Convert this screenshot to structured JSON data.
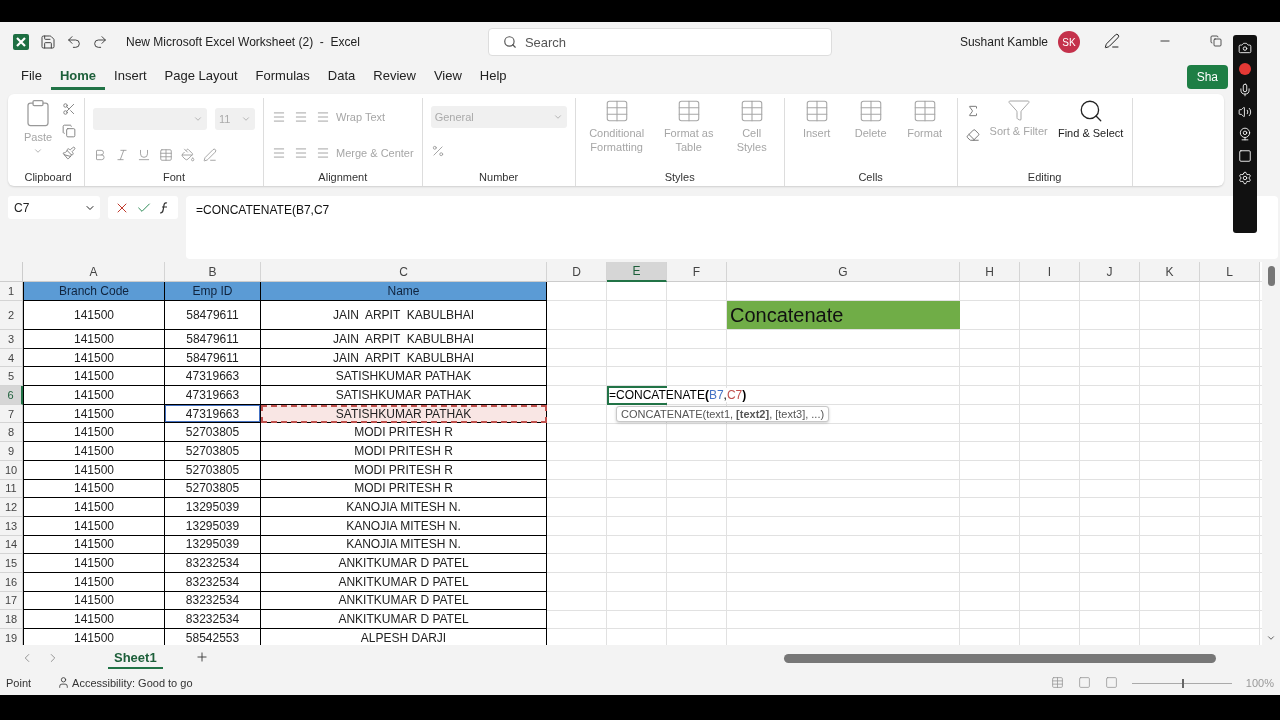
{
  "window": {
    "title": "New Microsoft Excel Worksheet (2)  -  Excel",
    "search_placeholder": "Search",
    "user_name": "Sushant Kamble",
    "user_initials": "SK",
    "share_label": "Sha"
  },
  "menu": [
    {
      "label": "File",
      "selected": false
    },
    {
      "label": "Home",
      "selected": true
    },
    {
      "label": "Insert",
      "selected": false
    },
    {
      "label": "Page Layout",
      "selected": false
    },
    {
      "label": "Formulas",
      "selected": false
    },
    {
      "label": "Data",
      "selected": false
    },
    {
      "label": "Review",
      "selected": false
    },
    {
      "label": "View",
      "selected": false
    },
    {
      "label": "Help",
      "selected": false
    }
  ],
  "ribbon": {
    "groups": [
      {
        "kind": "clipboard",
        "label": "Clipboard",
        "paste": {
          "label": "Paste",
          "disabled": true
        }
      },
      {
        "kind": "font",
        "label": "Font",
        "font_size": "11"
      },
      {
        "kind": "alignment",
        "label": "Alignment",
        "wrap": {
          "label": "Wrap Text",
          "disabled": true
        },
        "merge": {
          "label": "Merge & Center",
          "disabled": true
        }
      },
      {
        "kind": "number",
        "label": "Number",
        "format": "General"
      },
      {
        "kind": "buttons",
        "label": "Styles",
        "buttons": [
          {
            "label": "Conditional Formatting",
            "disabled": true
          },
          {
            "label": "Format as Table",
            "disabled": true
          },
          {
            "label": "Cell Styles",
            "disabled": true
          }
        ]
      },
      {
        "kind": "buttons",
        "label": "Cells",
        "buttons": [
          {
            "label": "Insert",
            "disabled": true
          },
          {
            "label": "Delete",
            "disabled": true
          },
          {
            "label": "Format",
            "disabled": true
          }
        ]
      },
      {
        "kind": "editing",
        "label": "Editing",
        "buttons": [
          {
            "label": "Sort & Filter",
            "disabled": true
          },
          {
            "label": "Find & Select",
            "disabled": false
          }
        ]
      }
    ]
  },
  "formula_bar": {
    "name_box": "C7",
    "formula": "=CONCATENATE(B7,C7"
  },
  "sheet": {
    "columns": [
      {
        "label": "A",
        "selected": false
      },
      {
        "label": "B",
        "selected": false
      },
      {
        "label": "C",
        "selected": false
      },
      {
        "label": "D",
        "selected": false
      },
      {
        "label": "E",
        "selected": true
      },
      {
        "label": "F",
        "selected": false
      },
      {
        "label": "G",
        "selected": false
      },
      {
        "label": "H",
        "selected": false
      },
      {
        "label": "I",
        "selected": false
      },
      {
        "label": "J",
        "selected": false
      },
      {
        "label": "K",
        "selected": false
      },
      {
        "label": "L",
        "selected": false
      }
    ],
    "rows": [
      {
        "label": "1",
        "selected": false,
        "cells": [
          {
            "text": "Branch Code",
            "kind": "header"
          },
          {
            "text": "Emp ID",
            "kind": "header"
          },
          {
            "text": "Name",
            "kind": "header"
          }
        ]
      },
      {
        "label": "2",
        "selected": false,
        "cells": [
          {
            "text": "141500",
            "kind": "plain"
          },
          {
            "text": "58479611",
            "kind": "plain"
          },
          {
            "text": "JAIN  ARPIT  KABULBHAI",
            "kind": "plain"
          }
        ],
        "side_label": "Concatenate"
      },
      {
        "label": "3",
        "selected": false,
        "cells": [
          {
            "text": "141500",
            "kind": "plain"
          },
          {
            "text": "58479611",
            "kind": "plain"
          },
          {
            "text": "JAIN  ARPIT  KABULBHAI",
            "kind": "plain"
          }
        ]
      },
      {
        "label": "4",
        "selected": false,
        "cells": [
          {
            "text": "141500",
            "kind": "plain"
          },
          {
            "text": "58479611",
            "kind": "plain"
          },
          {
            "text": "JAIN  ARPIT  KABULBHAI",
            "kind": "plain"
          }
        ]
      },
      {
        "label": "5",
        "selected": false,
        "cells": [
          {
            "text": "141500",
            "kind": "plain"
          },
          {
            "text": "47319663",
            "kind": "plain"
          },
          {
            "text": "SATISHKUMAR PATHAK",
            "kind": "plain"
          }
        ]
      },
      {
        "label": "6",
        "selected": true,
        "cells": [
          {
            "text": "141500",
            "kind": "plain"
          },
          {
            "text": "47319663",
            "kind": "plain"
          },
          {
            "text": "SATISHKUMAR PATHAK",
            "kind": "plain"
          }
        ],
        "entry": [
          {
            "text": "=CONCATENATE",
            "kind": "text"
          },
          {
            "text": "(",
            "kind": "bracket"
          },
          {
            "text": "B7",
            "kind": "reference",
            "color": "#4472c4"
          },
          {
            "text": ",",
            "kind": "text"
          },
          {
            "text": "C7",
            "kind": "reference",
            "color": "#c0504d"
          },
          {
            "text": ")",
            "kind": "bracket"
          }
        ]
      },
      {
        "label": "7",
        "selected": false,
        "cells": [
          {
            "text": "141500",
            "kind": "plain"
          },
          {
            "text": "47319663",
            "kind": "reference"
          },
          {
            "text": "SATISHKUMAR PATHAK",
            "kind": "marquee"
          }
        ],
        "tooltip": "CONCATENATE(text1, **[text2]**, [text3], ...)"
      },
      {
        "label": "8",
        "selected": false,
        "cells": [
          {
            "text": "141500",
            "kind": "plain"
          },
          {
            "text": "52703805",
            "kind": "plain"
          },
          {
            "text": "MODI PRITESH R",
            "kind": "plain"
          }
        ]
      },
      {
        "label": "9",
        "selected": false,
        "cells": [
          {
            "text": "141500",
            "kind": "plain"
          },
          {
            "text": "52703805",
            "kind": "plain"
          },
          {
            "text": "MODI PRITESH R",
            "kind": "plain"
          }
        ]
      },
      {
        "label": "10",
        "selected": false,
        "cells": [
          {
            "text": "141500",
            "kind": "plain"
          },
          {
            "text": "52703805",
            "kind": "plain"
          },
          {
            "text": "MODI PRITESH R",
            "kind": "plain"
          }
        ]
      },
      {
        "label": "11",
        "selected": false,
        "cells": [
          {
            "text": "141500",
            "kind": "plain"
          },
          {
            "text": "52703805",
            "kind": "plain"
          },
          {
            "text": "MODI PRITESH R",
            "kind": "plain"
          }
        ]
      },
      {
        "label": "12",
        "selected": false,
        "cells": [
          {
            "text": "141500",
            "kind": "plain"
          },
          {
            "text": "13295039",
            "kind": "plain"
          },
          {
            "text": "KANOJIA MITESH N.",
            "kind": "plain"
          }
        ]
      },
      {
        "label": "13",
        "selected": false,
        "cells": [
          {
            "text": "141500",
            "kind": "plain"
          },
          {
            "text": "13295039",
            "kind": "plain"
          },
          {
            "text": "KANOJIA MITESH N.",
            "kind": "plain"
          }
        ]
      },
      {
        "label": "14",
        "selected": false,
        "cells": [
          {
            "text": "141500",
            "kind": "plain"
          },
          {
            "text": "13295039",
            "kind": "plain"
          },
          {
            "text": "KANOJIA MITESH N.",
            "kind": "plain"
          }
        ]
      },
      {
        "label": "15",
        "selected": false,
        "cells": [
          {
            "text": "141500",
            "kind": "plain"
          },
          {
            "text": "83232534",
            "kind": "plain"
          },
          {
            "text": "ANKITKUMAR D PATEL",
            "kind": "plain"
          }
        ]
      },
      {
        "label": "16",
        "selected": false,
        "cells": [
          {
            "text": "141500",
            "kind": "plain"
          },
          {
            "text": "83232534",
            "kind": "plain"
          },
          {
            "text": "ANKITKUMAR D PATEL",
            "kind": "plain"
          }
        ]
      },
      {
        "label": "17",
        "selected": false,
        "cells": [
          {
            "text": "141500",
            "kind": "plain"
          },
          {
            "text": "83232534",
            "kind": "plain"
          },
          {
            "text": "ANKITKUMAR D PATEL",
            "kind": "plain"
          }
        ]
      },
      {
        "label": "18",
        "selected": false,
        "cells": [
          {
            "text": "141500",
            "kind": "plain"
          },
          {
            "text": "83232534",
            "kind": "plain"
          },
          {
            "text": "ANKITKUMAR D PATEL",
            "kind": "plain"
          }
        ]
      },
      {
        "label": "19",
        "selected": false,
        "cells": [
          {
            "text": "141500",
            "kind": "plain"
          },
          {
            "text": "58542553",
            "kind": "plain"
          },
          {
            "text": "ALPESH DARJI",
            "kind": "plain"
          }
        ]
      }
    ]
  },
  "sheet_tabs": [
    {
      "label": "Sheet1",
      "selected": true
    }
  ],
  "status_bar": {
    "mode": "Point",
    "accessibility": "Accessibility: Good to go",
    "zoom": "100%",
    "zoom_slider": {
      "level": 0.5
    }
  }
}
